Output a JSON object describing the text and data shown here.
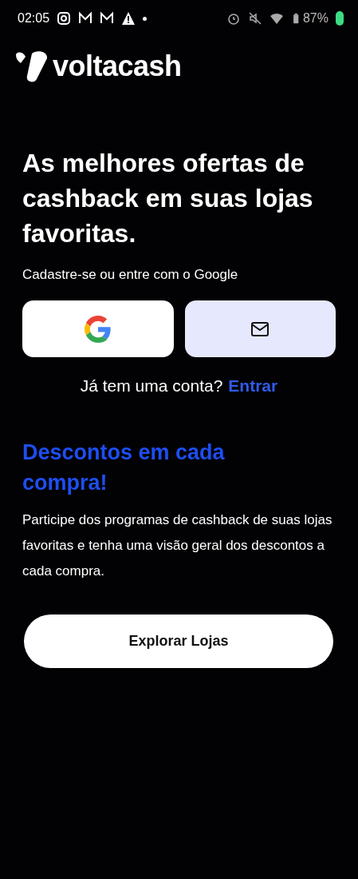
{
  "status_bar": {
    "time": "02:05",
    "battery": "87%"
  },
  "brand": {
    "name": "voltacash"
  },
  "headline": "As melhores ofertas de cashback em suas lojas favoritas.",
  "signup_prompt": "Cadastre-se ou entre com o Google",
  "login_prompt": {
    "text": "Já tem uma conta?",
    "link": "Entrar"
  },
  "section": {
    "title": "Descontos em cada compra!",
    "body": "Participe dos programas de cashback de suas lojas favoritas e tenha uma visão geral dos descontos a cada compra."
  },
  "cta": "Explorar Lojas"
}
